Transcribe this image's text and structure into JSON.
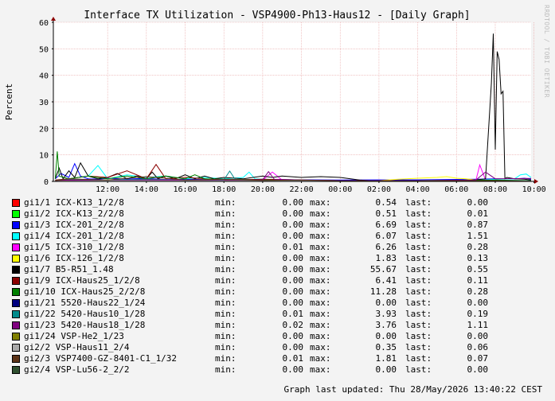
{
  "chart_data": {
    "type": "line",
    "title": "Interface TX Utilization - VSP4900-Ph13-Haus12 - [Daily Graph]",
    "ylabel": "Percent",
    "xlabel": "",
    "ylim": [
      0,
      60
    ],
    "yticks": [
      0,
      10,
      20,
      30,
      40,
      50,
      60
    ],
    "xticks": [
      "12:00",
      "14:00",
      "16:00",
      "18:00",
      "20:00",
      "22:00",
      "00:00",
      "02:00",
      "04:00",
      "06:00",
      "08:00",
      "10:00",
      "12:00"
    ],
    "x_range_hours": [
      9.2,
      33.85
    ],
    "grid": true,
    "legend_position": "bottom",
    "watermark": "RRDTOOL / TOBI OETIKER",
    "series": [
      {
        "name": "gi1/1 ICX-K13_1/2/8",
        "color": "#ff0000",
        "min": "0.00",
        "max": "0.54",
        "last": "0.00",
        "x": [
          9.3,
          9.8,
          10.5,
          11.2,
          12.3,
          13.0,
          13.8,
          14.6,
          16.0,
          17.5,
          20.0,
          24.0,
          28.0,
          31.0,
          33.5
        ],
        "y": [
          0.2,
          0.4,
          0.2,
          0.5,
          0.3,
          0.2,
          0.4,
          0.2,
          0.3,
          0.2,
          0.1,
          0.1,
          0.1,
          0.3,
          0.2
        ]
      },
      {
        "name": "gi1/2 ICX-K13_2/2/8",
        "color": "#00ff00",
        "min": "0.00",
        "max": "0.51",
        "last": "0.01",
        "x": [
          9.3,
          10.0,
          11.0,
          12.0,
          13.0,
          14.0,
          15.0,
          16.5,
          18.0,
          22.0,
          26.0,
          30.0,
          33.5
        ],
        "y": [
          0.3,
          0.5,
          0.2,
          0.4,
          0.3,
          0.5,
          0.2,
          0.3,
          0.1,
          0.1,
          0.1,
          0.2,
          0.1
        ]
      },
      {
        "name": "gi1/3 ICX-201_2/2/8",
        "color": "#0000ff",
        "min": "0.00",
        "max": "6.69",
        "last": "0.87",
        "x": [
          9.3,
          9.6,
          10.0,
          10.3,
          10.6,
          11.0,
          11.5,
          12.0,
          13.0,
          14.0,
          15.0,
          16.0,
          18.0,
          20.0,
          24.0,
          28.0,
          31.0,
          32.0,
          33.0,
          33.5,
          33.85
        ],
        "y": [
          1.0,
          3.0,
          1.5,
          6.7,
          2.0,
          1.0,
          0.8,
          1.2,
          0.9,
          1.1,
          0.7,
          0.8,
          0.6,
          0.7,
          0.5,
          0.6,
          0.8,
          1.0,
          0.9,
          1.2,
          0.87
        ]
      },
      {
        "name": "gi1/4 ICX-201_1/2/8",
        "color": "#00ffff",
        "min": "0.00",
        "max": "6.07",
        "last": "1.51",
        "x": [
          9.3,
          10.0,
          11.0,
          11.5,
          12.0,
          13.0,
          14.0,
          15.0,
          16.0,
          17.0,
          18.0,
          19.0,
          19.3,
          19.6,
          20.0,
          22.0,
          24.0,
          28.0,
          31.0,
          33.0,
          33.3,
          33.6,
          33.85
        ],
        "y": [
          0.5,
          1.0,
          2.0,
          6.0,
          1.0,
          2.5,
          1.5,
          2.0,
          1.0,
          1.5,
          1.0,
          1.5,
          3.5,
          1.0,
          0.8,
          0.5,
          0.3,
          0.3,
          0.5,
          1.0,
          2.5,
          2.8,
          1.51
        ]
      },
      {
        "name": "gi1/5 ICX-310_1/2/8",
        "color": "#ff00ff",
        "min": "0.01",
        "max": "6.26",
        "last": "0.28",
        "x": [
          9.3,
          10.0,
          12.0,
          14.0,
          16.0,
          18.0,
          20.0,
          20.5,
          21.0,
          24.0,
          28.0,
          31.0,
          31.2,
          31.5,
          32.0,
          33.0,
          33.85
        ],
        "y": [
          0.3,
          0.5,
          0.4,
          0.5,
          0.3,
          0.2,
          0.5,
          3.5,
          0.5,
          0.3,
          0.2,
          0.3,
          6.2,
          0.5,
          0.4,
          0.3,
          0.28
        ]
      },
      {
        "name": "gi1/6 ICX-126_1/2/8",
        "color": "#ffff00",
        "min": "0.00",
        "max": "1.83",
        "last": "0.13",
        "x": [
          9.3,
          12.0,
          16.0,
          20.0,
          24.0,
          26.0,
          27.0,
          28.0,
          29.0,
          29.5,
          30.0,
          30.5,
          31.0,
          32.0,
          33.85
        ],
        "y": [
          0.1,
          0.2,
          0.1,
          0.1,
          0.1,
          0.3,
          0.8,
          1.2,
          1.5,
          1.8,
          1.2,
          1.0,
          0.5,
          0.3,
          0.13
        ]
      },
      {
        "name": "gi1/7 B5-R51_1.48",
        "color": "#000000",
        "min": "0.00",
        "max": "55.67",
        "last": "0.55",
        "x": [
          9.3,
          9.5,
          9.7,
          10.0,
          10.3,
          10.6,
          11.0,
          11.5,
          12.0,
          12.5,
          13.0,
          13.5,
          14.0,
          14.3,
          14.6,
          15.0,
          15.5,
          16.0,
          16.5,
          17.0,
          17.5,
          18.0,
          19.0,
          20.0,
          20.5,
          21.0,
          22.0,
          23.0,
          24.0,
          25.0,
          25.5,
          26.0,
          27.0,
          28.0,
          29.0,
          30.0,
          31.0,
          31.5,
          31.8,
          31.9,
          32.0,
          32.1,
          32.2,
          32.3,
          32.4,
          32.5,
          32.6,
          33.0,
          33.5,
          33.85
        ],
        "y": [
          1.0,
          5.0,
          1.0,
          4.0,
          1.5,
          7.0,
          2.0,
          1.0,
          1.5,
          3.0,
          1.0,
          2.0,
          1.0,
          3.5,
          1.0,
          2.0,
          1.0,
          2.5,
          1.0,
          2.0,
          1.0,
          1.5,
          1.0,
          2.0,
          1.5,
          2.0,
          1.5,
          1.8,
          1.5,
          0.5,
          0.3,
          0.2,
          0.2,
          0.3,
          0.2,
          0.3,
          0.5,
          1.0,
          37.0,
          55.7,
          12.0,
          49.0,
          46.0,
          33.0,
          34.0,
          1.0,
          1.5,
          1.0,
          0.8,
          0.55
        ]
      },
      {
        "name": "gi1/9 ICX-Haus25_1/2/8",
        "color": "#8b0000",
        "min": "0.00",
        "max": "6.41",
        "last": "0.11",
        "x": [
          9.3,
          10.0,
          11.0,
          12.0,
          13.0,
          14.0,
          14.5,
          15.0,
          16.0,
          18.0,
          20.0,
          24.0,
          28.0,
          31.0,
          32.0,
          33.85
        ],
        "y": [
          0.5,
          1.0,
          2.0,
          1.5,
          4.0,
          1.0,
          6.4,
          1.0,
          1.5,
          0.5,
          0.8,
          0.3,
          0.2,
          0.5,
          0.3,
          0.11
        ]
      },
      {
        "name": "gi1/10 ICX-Haus25_2/2/8",
        "color": "#008000",
        "min": "0.00",
        "max": "11.28",
        "last": "0.28",
        "x": [
          9.3,
          9.4,
          9.5,
          10.0,
          11.0,
          12.0,
          13.0,
          14.0,
          15.0,
          16.0,
          16.5,
          17.0,
          18.0,
          20.0,
          24.0,
          28.0,
          32.0,
          33.85
        ],
        "y": [
          1.0,
          11.3,
          2.0,
          1.0,
          2.0,
          1.0,
          2.0,
          1.0,
          2.0,
          1.0,
          2.5,
          1.0,
          0.8,
          0.5,
          0.3,
          0.3,
          0.5,
          0.28
        ]
      },
      {
        "name": "gi1/21 5520-Haus22_1/24",
        "color": "#000080",
        "min": "0.00",
        "max": "0.00",
        "last": "0.00",
        "x": [
          9.3,
          33.85
        ],
        "y": [
          0.0,
          0.0
        ]
      },
      {
        "name": "gi1/22 5420-Haus10_1/28",
        "color": "#008b8b",
        "min": "0.01",
        "max": "3.93",
        "last": "0.19",
        "x": [
          9.3,
          10.0,
          12.0,
          14.0,
          16.0,
          18.0,
          18.3,
          18.6,
          20.0,
          24.0,
          28.0,
          32.0,
          33.85
        ],
        "y": [
          0.3,
          0.8,
          0.5,
          0.8,
          0.5,
          0.6,
          3.9,
          0.5,
          0.4,
          0.2,
          0.2,
          0.3,
          0.19
        ]
      },
      {
        "name": "gi1/23 5420-Haus18_1/28",
        "color": "#800080",
        "min": "0.02",
        "max": "3.76",
        "last": "1.11",
        "x": [
          9.3,
          10.0,
          12.0,
          14.0,
          16.0,
          18.0,
          20.0,
          20.3,
          20.6,
          22.0,
          24.0,
          28.0,
          31.0,
          31.5,
          32.0,
          33.85
        ],
        "y": [
          0.3,
          0.5,
          0.4,
          0.6,
          0.5,
          0.4,
          0.6,
          3.7,
          0.8,
          0.5,
          0.3,
          0.3,
          0.5,
          3.5,
          1.0,
          1.11
        ]
      },
      {
        "name": "gi1/24 VSP-He2_1/23",
        "color": "#808000",
        "min": "0.00",
        "max": "0.00",
        "last": "0.00",
        "x": [
          9.3,
          33.85
        ],
        "y": [
          0.0,
          0.0
        ]
      },
      {
        "name": "gi2/2 VSP-Haus11_2/4",
        "color": "#a9a9a9",
        "min": "0.00",
        "max": "0.35",
        "last": "0.06",
        "x": [
          9.3,
          12.0,
          16.0,
          20.0,
          24.0,
          28.0,
          32.0,
          33.85
        ],
        "y": [
          0.1,
          0.3,
          0.2,
          0.2,
          0.1,
          0.1,
          0.2,
          0.06
        ]
      },
      {
        "name": "gi2/3 VSP7400-GZ-8401-C1_1/32",
        "color": "#5c3317",
        "min": "0.01",
        "max": "1.81",
        "last": "0.07",
        "x": [
          9.3,
          10.0,
          12.0,
          14.0,
          16.0,
          18.0,
          20.0,
          22.0,
          24.0,
          28.0,
          32.0,
          33.85
        ],
        "y": [
          0.3,
          1.0,
          0.5,
          1.8,
          0.5,
          0.8,
          0.4,
          0.5,
          0.2,
          0.2,
          0.3,
          0.07
        ]
      },
      {
        "name": "gi2/4 VSP-Lu56-2_2/2",
        "color": "#2f4f2f",
        "min": "0.00",
        "max": "0.00",
        "last": "0.00",
        "x": [
          9.3,
          33.85
        ],
        "y": [
          0.0,
          0.0
        ]
      }
    ]
  },
  "legend_labels": {
    "min": "min:",
    "max": "max:",
    "last": "last:"
  },
  "footer": "Graph last updated: Thu 28/May/2026 13:40:22 CEST"
}
